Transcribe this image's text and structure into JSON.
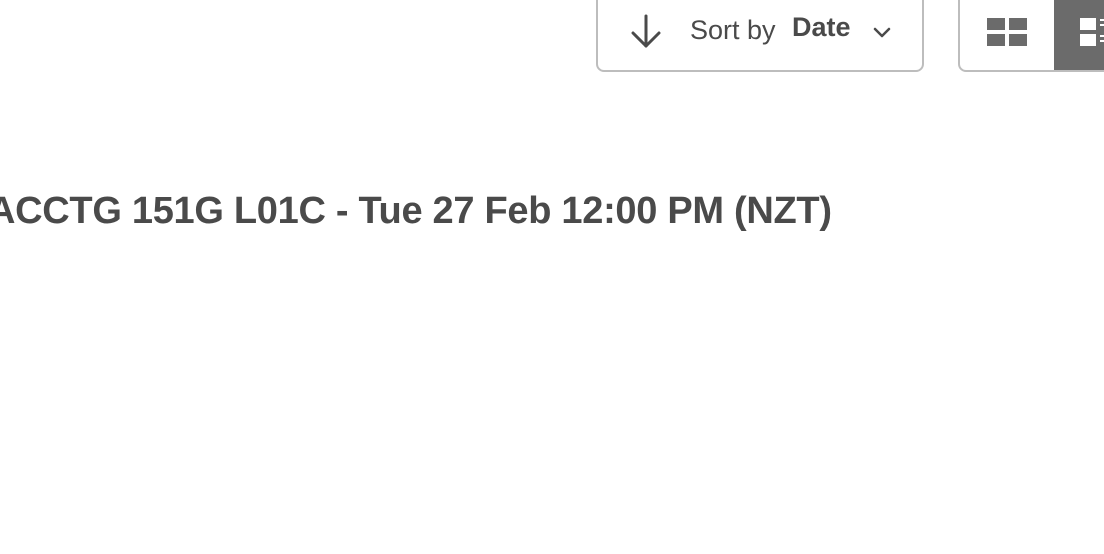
{
  "sort": {
    "prefix": "Sort by",
    "value": "Date",
    "arrow_icon": "arrow-down-icon",
    "chevron_icon": "chevron-down-icon"
  },
  "view_toggle": {
    "grid_icon": "grid-view-icon",
    "list_icon": "list-view-icon",
    "active": "list"
  },
  "session": {
    "title": "ACCTG 151G L01C - Tue 27 Feb 12:00 PM (NZT)"
  },
  "colors": {
    "text": "#4a4a4a",
    "border": "#bdbdbd",
    "active_toggle_bg": "#6b6b6b"
  }
}
